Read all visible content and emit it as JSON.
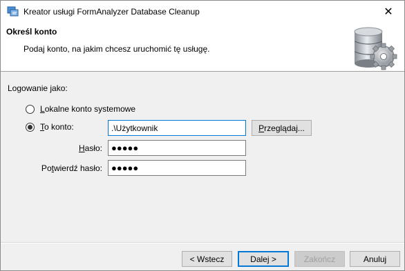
{
  "window": {
    "title": "Kreator usługi FormAnalyzer Database Cleanup",
    "close_glyph": "✕"
  },
  "header": {
    "title": "Określ konto",
    "subtitle": "Podaj konto, na jakim chcesz uruchomić tę usługę.",
    "icon": "database-gear-icon"
  },
  "form": {
    "section_label": "Logowanie jako:",
    "local_system": {
      "label_prefix": "L",
      "label_rest": "okalne konto systemowe",
      "checked": false
    },
    "this_account": {
      "label_prefix": "T",
      "label_rest": "o konto:",
      "checked": true,
      "value": ".\\Użytkownik"
    },
    "browse_button": {
      "label_prefix": "P",
      "label_rest": "rzeglądaj..."
    },
    "password": {
      "label_prefix": "H",
      "label_rest": "asło:",
      "value": "●●●●●"
    },
    "confirm_password": {
      "label_prefix": "P",
      "label_mid": "o",
      "label_underlined": "t",
      "label_rest": "wierdź hasło:",
      "value": "●●●●●"
    }
  },
  "footer": {
    "back": "< Wstecz",
    "next": "Dalej >",
    "finish": "Zakończ",
    "cancel": "Anuluj"
  },
  "colors": {
    "accent": "#0078d7",
    "header_bg": "#ffffff",
    "body_bg": "#f0f0f0"
  }
}
